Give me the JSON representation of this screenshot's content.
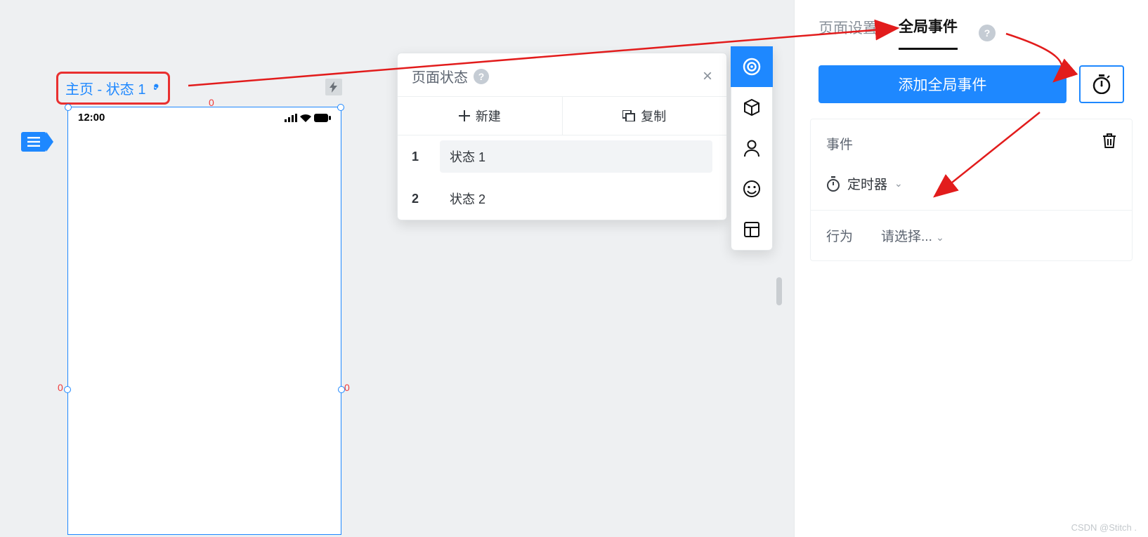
{
  "canvas": {
    "page_label": "主页 - 状态 1",
    "time": "12:00",
    "dim_top": "0",
    "dim_left": "0",
    "dim_right": "0"
  },
  "popover": {
    "title": "页面状态",
    "new_label": "新建",
    "copy_label": "复制",
    "states": [
      {
        "idx": "1",
        "name": "状态 1"
      },
      {
        "idx": "2",
        "name": "状态 2"
      }
    ]
  },
  "right": {
    "tabs": {
      "page_settings": "页面设置",
      "global_events": "全局事件"
    },
    "add_button": "添加全局事件",
    "event_section_label": "事件",
    "event_type": "定时器",
    "action_label": "行为",
    "action_placeholder": "请选择..."
  },
  "watermark": "CSDN @Stitch ."
}
